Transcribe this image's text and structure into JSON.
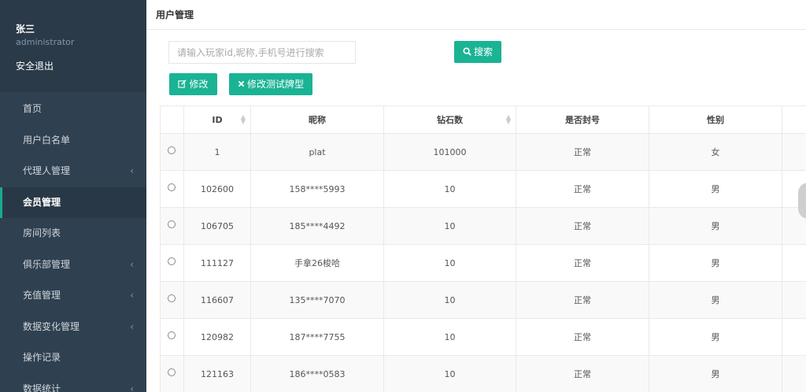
{
  "user": {
    "name": "张三",
    "role": "administrator",
    "logout_label": "安全退出"
  },
  "sidebar": {
    "items": [
      {
        "label": "首页",
        "has_arrow": false,
        "active": false
      },
      {
        "label": "用户白名单",
        "has_arrow": false,
        "active": false
      },
      {
        "label": "代理人管理",
        "has_arrow": true,
        "active": false
      },
      {
        "label": "会员管理",
        "has_arrow": false,
        "active": true
      },
      {
        "label": "房间列表",
        "has_arrow": false,
        "active": false
      },
      {
        "label": "俱乐部管理",
        "has_arrow": true,
        "active": false
      },
      {
        "label": "充值管理",
        "has_arrow": true,
        "active": false
      },
      {
        "label": "数据变化管理",
        "has_arrow": true,
        "active": false
      },
      {
        "label": "操作记录",
        "has_arrow": false,
        "active": false
      },
      {
        "label": "数据统计",
        "has_arrow": true,
        "active": false
      }
    ],
    "arrow_glyph": "‹"
  },
  "page": {
    "title": "用户管理"
  },
  "search": {
    "placeholder": "请输入玩家id,昵称,手机号进行搜索",
    "button_label": "搜索"
  },
  "toolbar": {
    "edit_label": "修改",
    "edit_test_label": "修改测试牌型"
  },
  "table": {
    "columns": [
      "",
      "ID",
      "昵称",
      "钻石数",
      "是否封号",
      "性别",
      ""
    ],
    "rows": [
      {
        "id": "1",
        "nickname": "plat",
        "diamonds": "101000",
        "status": "正常",
        "gender": "女"
      },
      {
        "id": "102600",
        "nickname": "158****5993",
        "diamonds": "10",
        "status": "正常",
        "gender": "男"
      },
      {
        "id": "106705",
        "nickname": "185****4492",
        "diamonds": "10",
        "status": "正常",
        "gender": "男"
      },
      {
        "id": "111127",
        "nickname": "手拿26梭哈",
        "diamonds": "10",
        "status": "正常",
        "gender": "男"
      },
      {
        "id": "116607",
        "nickname": "135****7070",
        "diamonds": "10",
        "status": "正常",
        "gender": "男"
      },
      {
        "id": "120982",
        "nickname": "187****7755",
        "diamonds": "10",
        "status": "正常",
        "gender": "男"
      },
      {
        "id": "121163",
        "nickname": "186****0583",
        "diamonds": "10",
        "status": "正常",
        "gender": "男"
      }
    ]
  },
  "colors": {
    "sidebar_bg": "#2f4050",
    "accent": "#1ab394"
  }
}
